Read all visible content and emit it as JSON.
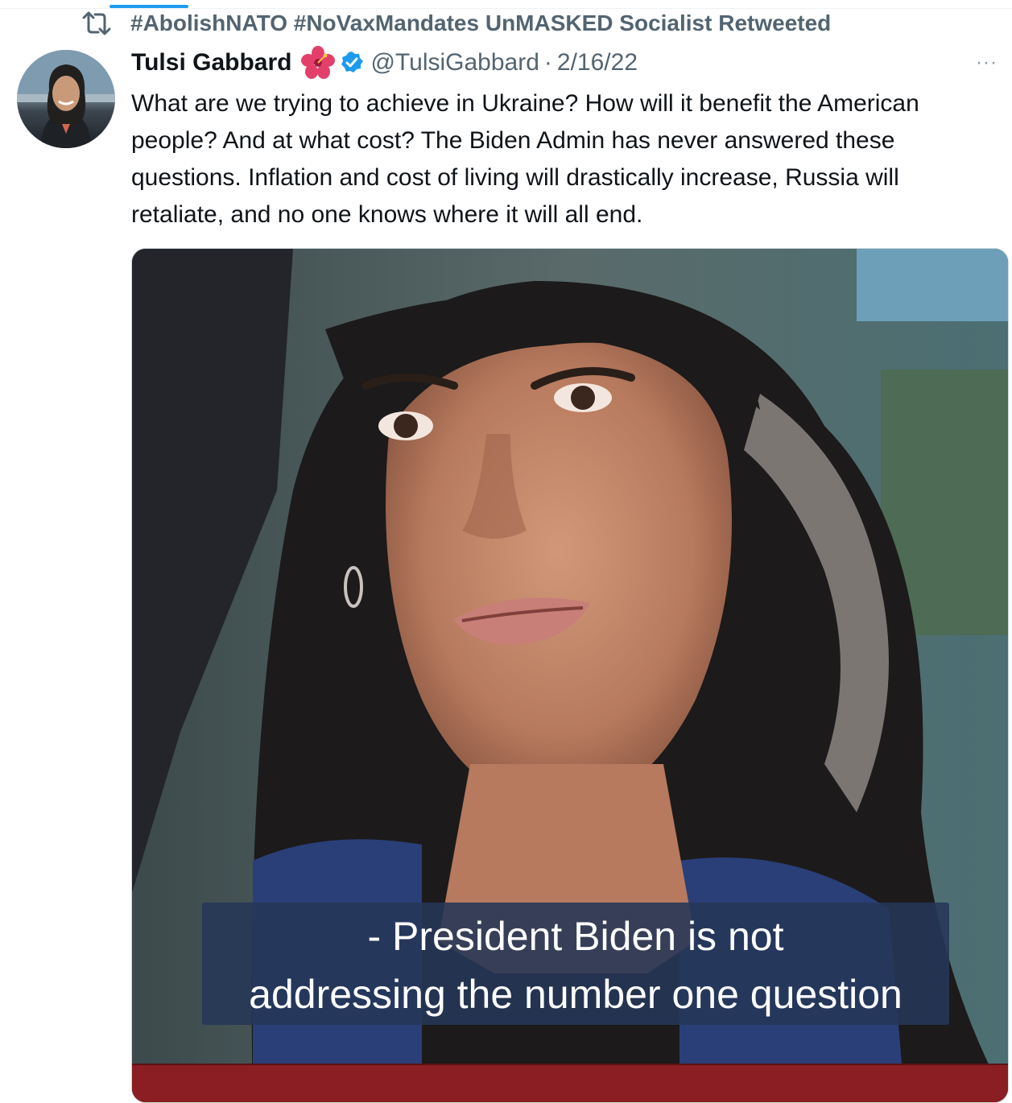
{
  "social_context": {
    "text": "#AbolishNATO #NoVaxMandates UnMASKED Socialist Retweeted",
    "icon": "retweet-icon"
  },
  "tweet": {
    "author_name": "Tulsi Gabbard",
    "author_emoji_icon": "hibiscus-icon",
    "verified_icon": "verified-badge-icon",
    "handle": "@TulsiGabbard",
    "separator": "·",
    "date": "2/16/22",
    "more_label": "···",
    "text": "What are we trying to achieve in Ukraine? How will it benefit the American people? And at what cost? The Biden Admin has never answered these questions. Inflation and cost of living will drastically increase, Russia will retaliate, and no one knows where it will all end.",
    "media": {
      "caption_line1": "- President Biden is not",
      "caption_line2": "addressing the number one question"
    }
  },
  "colors": {
    "accent": "#1d9bf0",
    "secondary_text": "#536471",
    "primary_text": "#0f1419",
    "caption_bg": "#263758"
  }
}
